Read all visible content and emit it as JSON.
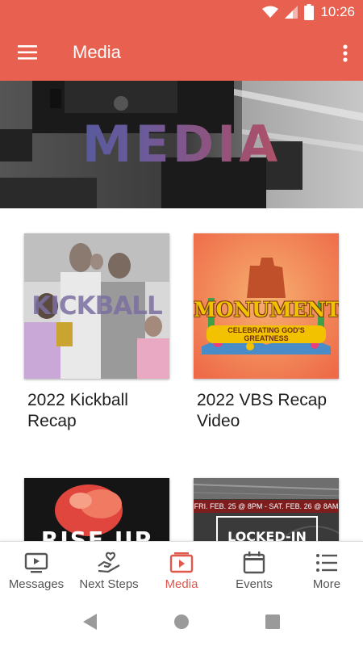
{
  "status_bar": {
    "time": "10:26"
  },
  "app_bar": {
    "title": "Media"
  },
  "hero": {
    "text": "MEDIA"
  },
  "media_items": [
    {
      "title": "2022 Kickball Recap",
      "thumb_text": "KICKBALL"
    },
    {
      "title": "2022 VBS Recap Video",
      "thumb_text": "MONUMENTAL",
      "thumb_subtext": "CELEBRATING GOD'S GREATNESS"
    },
    {
      "title": "",
      "thumb_text": "RISE UP"
    },
    {
      "title": "",
      "thumb_date": "FRI. FEB. 25 @ 8PM - SAT. FEB. 26 @ 8AM",
      "thumb_text": "LOCKED-IN"
    }
  ],
  "bottom_nav": [
    {
      "label": "Messages",
      "icon": "tv-icon"
    },
    {
      "label": "Next Steps",
      "icon": "hand-heart-icon"
    },
    {
      "label": "Media",
      "icon": "media-play-icon",
      "active": true
    },
    {
      "label": "Events",
      "icon": "calendar-icon"
    },
    {
      "label": "More",
      "icon": "list-menu-icon"
    }
  ],
  "colors": {
    "brand": "#e8604f",
    "active_nav": "#e0574c",
    "inactive_nav": "#555555"
  }
}
